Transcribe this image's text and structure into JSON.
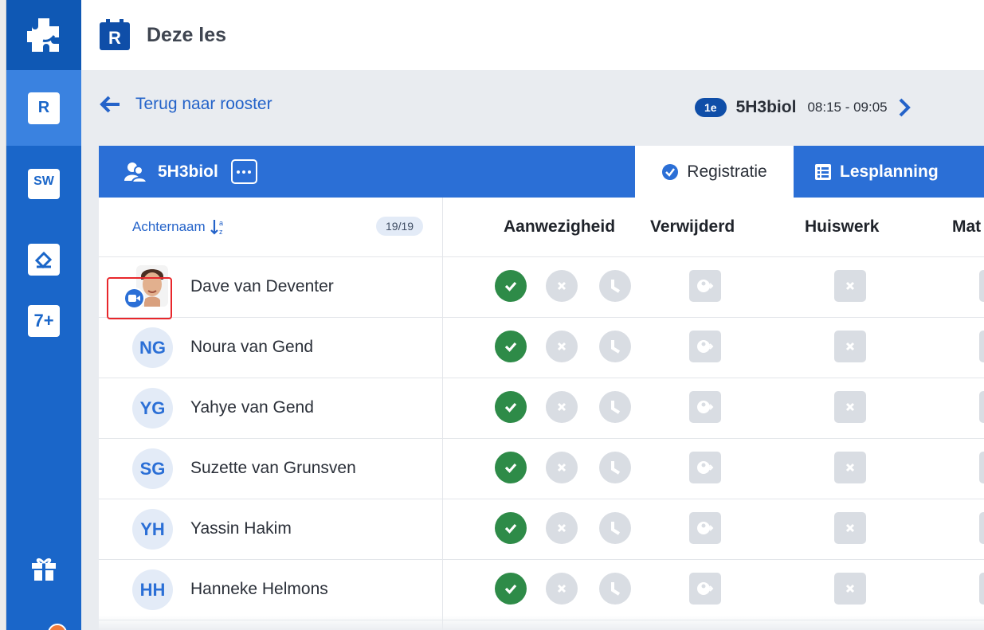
{
  "header": {
    "title": "Deze les"
  },
  "sidebar": {
    "items": [
      {
        "icon": "puzzle-logo-icon"
      },
      {
        "icon": "calendar-r-icon",
        "label": "R",
        "active": true
      },
      {
        "icon": "sw-icon",
        "label": "SW"
      },
      {
        "icon": "edit-icon"
      },
      {
        "icon": "seven-plus-icon",
        "label": "7+"
      },
      {
        "icon": "gift-icon"
      }
    ]
  },
  "nav": {
    "back_label": "Terug naar rooster",
    "hour": "1e",
    "group": "5H3biol",
    "time": "08:15 - 09:05"
  },
  "card": {
    "group_title": "5H3biol",
    "tabs": [
      {
        "label": "Registratie",
        "active": true
      },
      {
        "label": "Lesplanning",
        "active": false
      }
    ]
  },
  "table": {
    "sort_label": "Achternaam",
    "count": "19/19",
    "columns": [
      "Aanwezigheid",
      "Verwijderd",
      "Huiswerk",
      "Mat"
    ],
    "students": [
      {
        "initials": "",
        "name": "Dave van Deventer",
        "photo": true,
        "video": true
      },
      {
        "initials": "NG",
        "name": "Noura van Gend"
      },
      {
        "initials": "YG",
        "name": "Yahye van Gend"
      },
      {
        "initials": "SG",
        "name": "Suzette van Grunsven"
      },
      {
        "initials": "YH",
        "name": "Yassin Hakim"
      },
      {
        "initials": "HH",
        "name": "Hanneke Helmons"
      }
    ]
  },
  "colors": {
    "primary": "#2b6fd6",
    "sidebar": "#1a66c9",
    "present": "#2e8b48",
    "inactive": "#d9dde3",
    "highlight": "#e8272b"
  }
}
